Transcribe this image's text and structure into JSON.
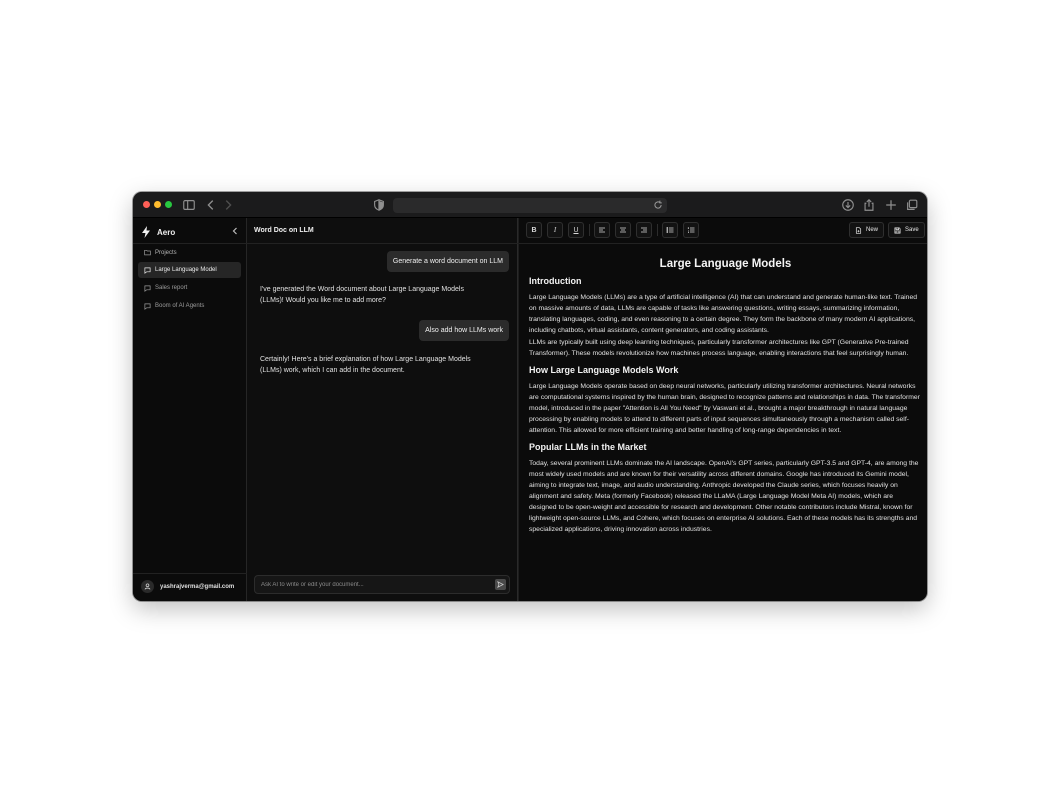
{
  "app": {
    "brand_name": "Aero"
  },
  "sidebar": {
    "section_label": "Projects",
    "items": [
      {
        "label": "Large Language Model",
        "active": true
      },
      {
        "label": "Sales report",
        "active": false
      },
      {
        "label": "Boom of AI Agents",
        "active": false
      }
    ],
    "user_email": "yashrajverma@gmail.com"
  },
  "chat": {
    "title": "Word Doc on LLM",
    "messages": [
      {
        "role": "user",
        "text": "Generate a word document on LLM"
      },
      {
        "role": "assistant",
        "text": "I've generated the Word document about Large Language Models (LLMs)! Would you like me to add more?"
      },
      {
        "role": "user",
        "text": "Also add how LLMs work"
      },
      {
        "role": "assistant",
        "text": "Certainly! Here's a brief explanation of how Large Language Models (LLMs) work, which I can add in the document."
      }
    ],
    "input_placeholder": "Ask AI to write or edit your document..."
  },
  "toolbar": {
    "bold": "B",
    "italic": "I",
    "underline": "U",
    "new_label": "New",
    "save_label": "Save"
  },
  "document": {
    "title": "Large Language Models",
    "sections": [
      {
        "heading": "Introduction",
        "paragraphs": [
          "Large Language Models (LLMs) are a type of artificial intelligence (AI) that can understand and generate human-like text. Trained on massive amounts of data, LLMs are capable of tasks like answering questions, writing essays, summarizing information, translating languages, coding, and even reasoning to a certain degree. They form the backbone of many modern AI applications, including chatbots, virtual assistants, content generators, and coding assistants.",
          "LLMs are typically built using deep learning techniques, particularly transformer architectures like GPT (Generative Pre-trained Transformer). These models revolutionize how machines process language, enabling interactions that feel surprisingly human."
        ]
      },
      {
        "heading": "How Large Language Models Work",
        "paragraphs": [
          "Large Language Models operate based on deep neural networks, particularly utilizing transformer architectures. Neural networks are computational systems inspired by the human brain, designed to recognize patterns and relationships in data. The transformer model, introduced in the paper \"Attention is All You Need\" by Vaswani et al., brought a major breakthrough in natural language processing by enabling models to attend to different parts of input sequences simultaneously through a mechanism called self-attention. This allowed for more efficient training and better handling of long-range dependencies in text."
        ]
      },
      {
        "heading": "Popular LLMs in the Market",
        "paragraphs": [
          "Today, several prominent LLMs dominate the AI landscape. OpenAI's GPT series, particularly GPT-3.5 and GPT-4, are among the most widely used models and are known for their versatility across different domains. Google has introduced its Gemini model, aiming to integrate text, image, and audio understanding. Anthropic developed the Claude series, which focuses heavily on alignment and safety. Meta (formerly Facebook) released the LLaMA (Large Language Model Meta AI) models, which are designed to be open-weight and accessible for research and development. Other notable contributors include Mistral, known for lightweight open-source LLMs, and Cohere, which focuses on enterprise AI solutions. Each of these models has its strengths and specialized applications, driving innovation across industries."
        ]
      }
    ]
  }
}
